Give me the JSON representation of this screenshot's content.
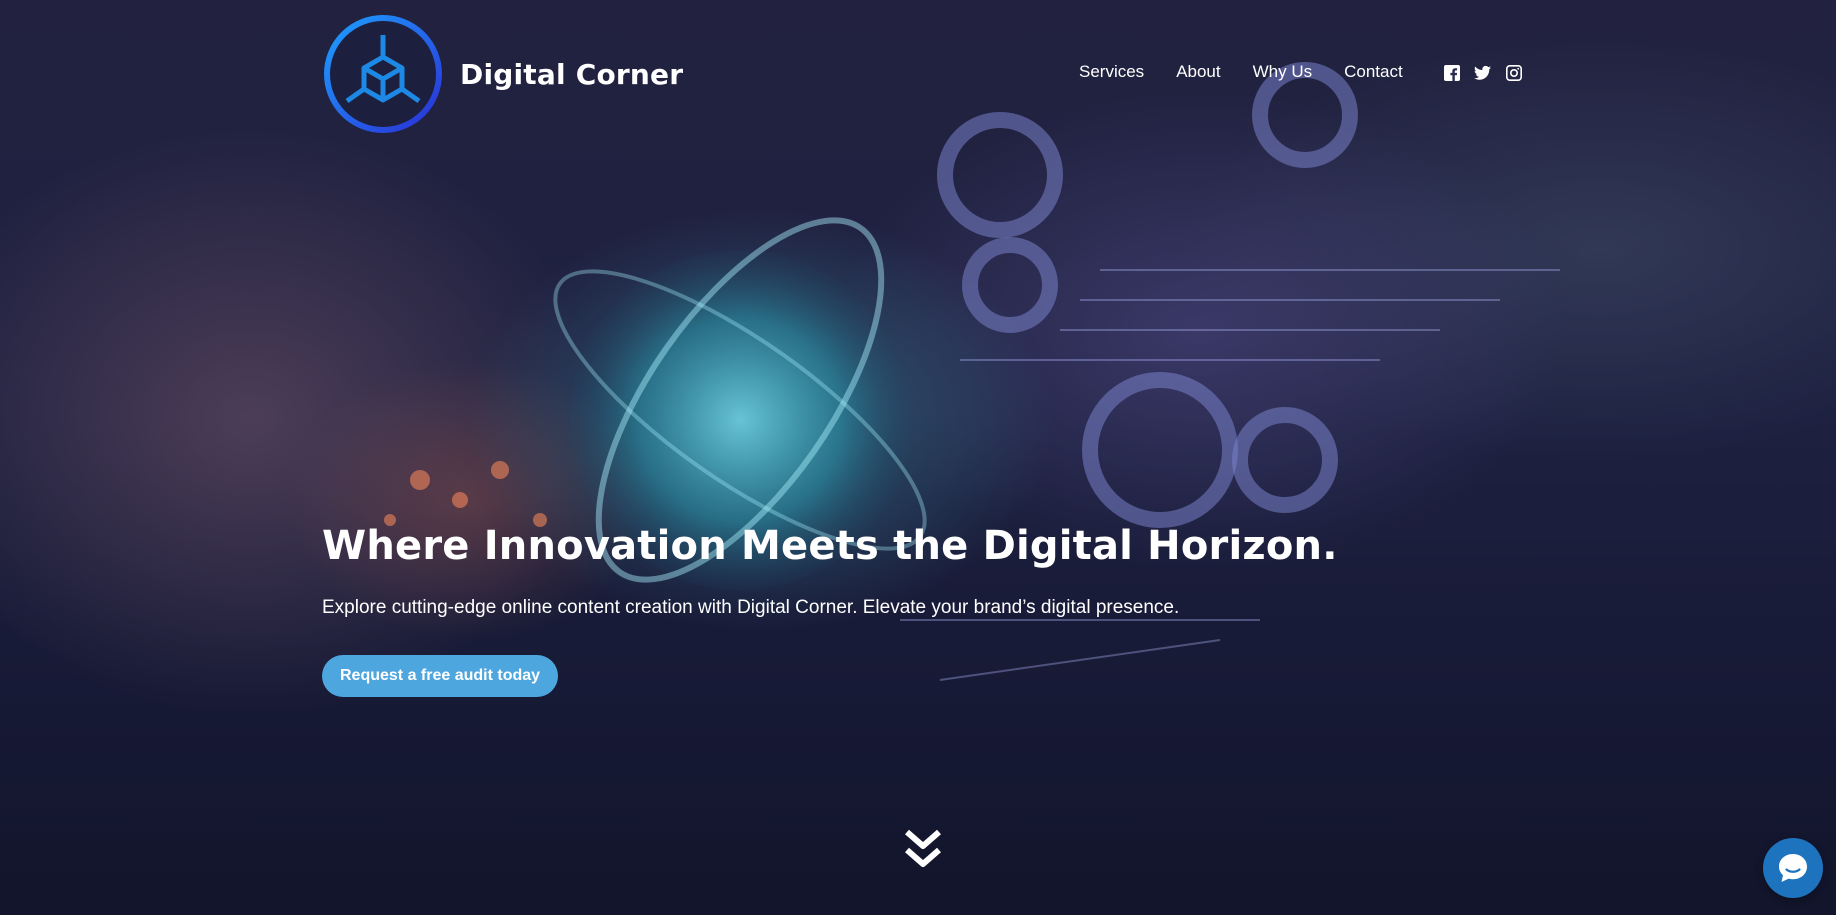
{
  "brand": {
    "name": "Digital Corner",
    "logo_icon": "cube-network-icon"
  },
  "nav": {
    "items": [
      "Services",
      "About",
      "Why Us",
      "Contact"
    ]
  },
  "social": [
    {
      "name": "facebook-icon"
    },
    {
      "name": "twitter-icon"
    },
    {
      "name": "instagram-icon"
    }
  ],
  "hero": {
    "headline": "Where Innovation Meets the Digital Horizon.",
    "subline": "Explore cutting-edge online content creation with Digital Corner. Elevate your brand’s digital presence.",
    "cta_label": "Request a free audit today"
  },
  "scroll_icon": "double-chevron-down-icon",
  "chat_icon": "chat-bubble-icon",
  "colors": {
    "accent": "#4ea6df",
    "chat": "#1e73be",
    "logo_ring_start": "#1ea0ff",
    "logo_ring_end": "#2a2fd6"
  }
}
